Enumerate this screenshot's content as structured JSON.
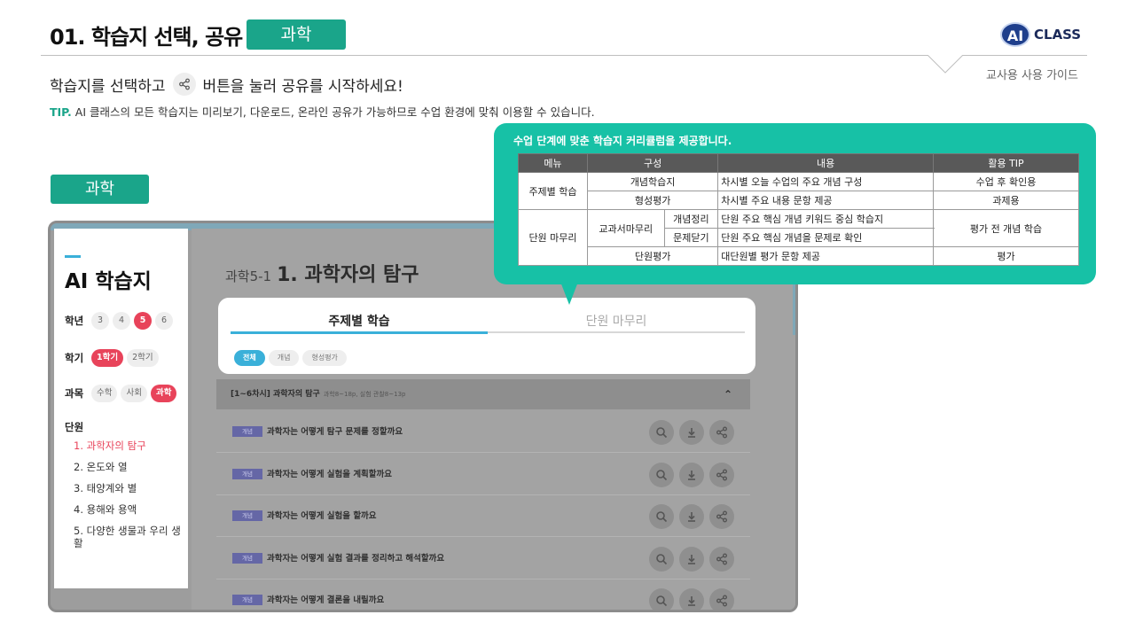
{
  "header": {
    "title": "01. 학습지 선택, 공유",
    "title_badge": "과학",
    "logo_mark": "AI",
    "logo_text": "CLASS",
    "guide_label": "교사용 사용 가이드"
  },
  "intro": {
    "subtitle_before": "학습지를 선택하고",
    "subtitle_icon": "share-icon",
    "subtitle_after": "버튼을 눌러 공유를 시작하세요!",
    "tip_label": "TIP.",
    "tip_text": "AI 클래스의 모든 학습지는 미리보기, 다운로드, 온라인 공유가 가능하므로 수업 환경에 맞춰 이용할 수 있습니다."
  },
  "section_badge": "과학",
  "app": {
    "sidebar": {
      "title": "AI 학습지",
      "grade": {
        "label": "학년",
        "options": [
          "3",
          "4",
          "5",
          "6"
        ],
        "selected": "5"
      },
      "semester": {
        "label": "학기",
        "options": [
          "1학기",
          "2학기"
        ],
        "selected": "1학기"
      },
      "subject": {
        "label": "과목",
        "options": [
          "수학",
          "사회",
          "과학"
        ],
        "selected": "과학"
      },
      "unit_label": "단원",
      "units": [
        "1. 과학자의 탐구",
        "2. 온도와 열",
        "3. 태양계와 별",
        "4. 용해와 용액",
        "5. 다양한 생물과 우리 생활"
      ],
      "active_unit": 0
    },
    "chapter_code": "과학5-1",
    "chapter_title": "1. 과학자의 탐구",
    "tabs": [
      "주제별 학습",
      "단원 마무리"
    ],
    "active_tab": 0,
    "filters": [
      "전체",
      "개념",
      "형성평가"
    ],
    "active_filter": 0,
    "group": {
      "title": "[1~6차시] 과학자의 탐구",
      "meta": "과학8~18p, 실험 관찰8~13p",
      "caret": "⌃"
    },
    "items": [
      {
        "tag": "개념",
        "title": "과학자는 어떻게 탐구 문제를 정할까요"
      },
      {
        "tag": "개념",
        "title": "과학자는 어떻게 실험을 계획할까요"
      },
      {
        "tag": "개념",
        "title": "과학자는 어떻게 실험을 할까요"
      },
      {
        "tag": "개념",
        "title": "과학자는 어떻게 실험 결과를 정리하고 해석할까요"
      },
      {
        "tag": "개념",
        "title": "과학자는 어떻게 결론을 내릴까요"
      }
    ],
    "item_actions": [
      "search-icon",
      "download-icon",
      "share-icon"
    ]
  },
  "callout": {
    "title": "수업 단계에 맞춘 학습지 커리큘럼을 제공합니다.",
    "headers": [
      "메뉴",
      "구성",
      "내용",
      "활용 TIP"
    ],
    "menu1": "주제별 학습",
    "menu1_rows": [
      {
        "part": "개념학습지",
        "content": "차시별 오늘 수업의 주요 개념 구성",
        "tip": "수업 후 확인용"
      },
      {
        "part": "형성평가",
        "content": "차시별 주요 내용 문항 제공",
        "tip": "과제용"
      }
    ],
    "menu2": "단원 마무리",
    "menu2_sub": "교과서마무리",
    "menu2_sub_rows": [
      {
        "part": "개념정리",
        "content": "단원 주요 핵심 개념 키워드 중심 학습지"
      },
      {
        "part": "문제닫기",
        "content": "단원 주요 핵심 개념을 문제로 확인"
      }
    ],
    "menu2_sub_tip": "평가 전 개념 학습",
    "menu2_last": {
      "part": "단원평가",
      "content": "대단원별 평가 문항 제공",
      "tip": "평가"
    }
  }
}
